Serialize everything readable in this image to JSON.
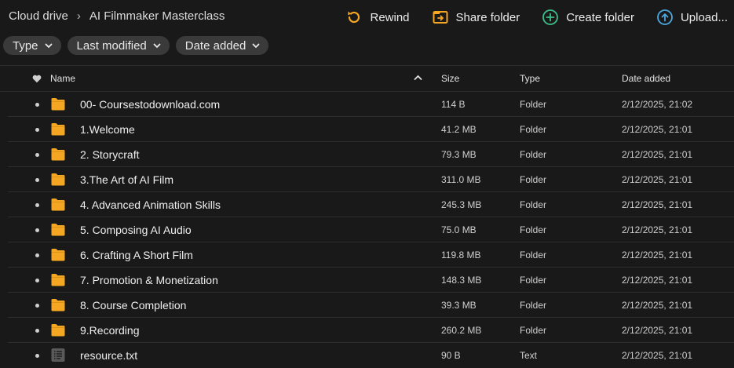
{
  "breadcrumb": {
    "root": "Cloud drive",
    "current": "AI Filmmaker Masterclass"
  },
  "actions": {
    "rewind": "Rewind",
    "share": "Share folder",
    "create": "Create folder",
    "upload": "Upload..."
  },
  "filters": {
    "type": "Type",
    "last_modified": "Last modified",
    "date_added": "Date added"
  },
  "columns": {
    "name": "Name",
    "size": "Size",
    "type": "Type",
    "date": "Date added"
  },
  "colors": {
    "folder": "#F5A623",
    "rewind": "#F5A623",
    "share": "#F5A623",
    "create": "#3DBE8A",
    "upload": "#4AA8E0"
  },
  "rows": [
    {
      "name": "00- Coursestodownload.com",
      "size": "114 B",
      "type": "Folder",
      "date": "2/12/2025, 21:02",
      "icon": "folder-icon"
    },
    {
      "name": "1.Welcome",
      "size": "41.2 MB",
      "type": "Folder",
      "date": "2/12/2025, 21:01",
      "icon": "folder-icon"
    },
    {
      "name": "2. Storycraft",
      "size": "79.3 MB",
      "type": "Folder",
      "date": "2/12/2025, 21:01",
      "icon": "folder-icon"
    },
    {
      "name": "3.The Art of AI Film",
      "size": "311.0 MB",
      "type": "Folder",
      "date": "2/12/2025, 21:01",
      "icon": "folder-icon"
    },
    {
      "name": "4. Advanced Animation Skills",
      "size": "245.3 MB",
      "type": "Folder",
      "date": "2/12/2025, 21:01",
      "icon": "folder-icon"
    },
    {
      "name": "5. Composing AI Audio",
      "size": "75.0 MB",
      "type": "Folder",
      "date": "2/12/2025, 21:01",
      "icon": "folder-icon"
    },
    {
      "name": "6. Crafting A Short Film",
      "size": "119.8 MB",
      "type": "Folder",
      "date": "2/12/2025, 21:01",
      "icon": "folder-icon"
    },
    {
      "name": "7. Promotion & Monetization",
      "size": "148.3 MB",
      "type": "Folder",
      "date": "2/12/2025, 21:01",
      "icon": "folder-icon"
    },
    {
      "name": "8. Course Completion",
      "size": "39.3 MB",
      "type": "Folder",
      "date": "2/12/2025, 21:01",
      "icon": "folder-icon"
    },
    {
      "name": "9.Recording",
      "size": "260.2 MB",
      "type": "Folder",
      "date": "2/12/2025, 21:01",
      "icon": "folder-icon"
    },
    {
      "name": "resource.txt",
      "size": "90 B",
      "type": "Text",
      "date": "2/12/2025, 21:01",
      "icon": "text-file-icon"
    }
  ]
}
